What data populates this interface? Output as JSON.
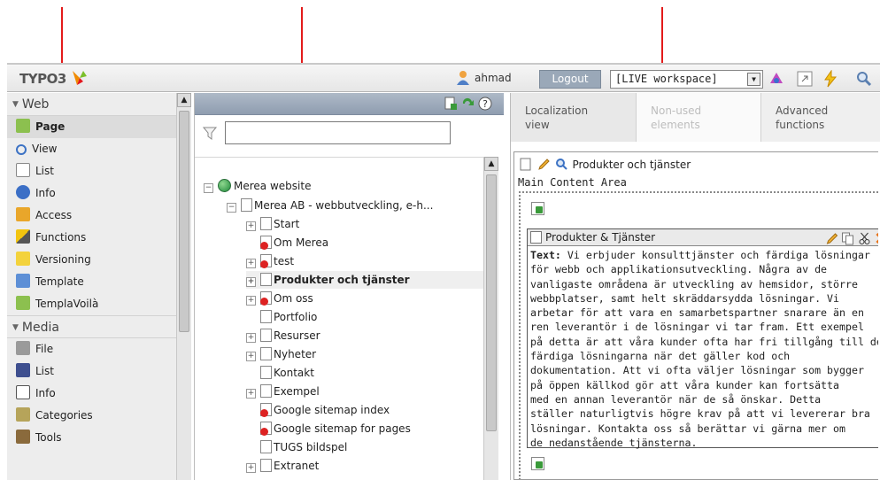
{
  "topbar": {
    "logo_text": "TYPO3",
    "username": "ahmad",
    "logout_label": "Logout",
    "workspace_value": "[LIVE workspace]"
  },
  "modules": {
    "web": {
      "label": "Web",
      "items": [
        {
          "label": "Page",
          "icon": "page-module-icon",
          "active": true
        },
        {
          "label": "View",
          "icon": "magnifier-icon"
        },
        {
          "label": "List",
          "icon": "list-icon"
        },
        {
          "label": "Info",
          "icon": "info-icon"
        },
        {
          "label": "Access",
          "icon": "lock-icon"
        },
        {
          "label": "Functions",
          "icon": "wand-icon"
        },
        {
          "label": "Versioning",
          "icon": "versioning-icon"
        },
        {
          "label": "Template",
          "icon": "template-icon"
        },
        {
          "label": "TemplaVoilà",
          "icon": "templavoila-icon"
        }
      ]
    },
    "media": {
      "label": "Media",
      "items": [
        {
          "label": "File",
          "icon": "folder-icon"
        },
        {
          "label": "List",
          "icon": "list-icon"
        },
        {
          "label": "Info",
          "icon": "info-icon"
        },
        {
          "label": "Categories",
          "icon": "categories-icon"
        },
        {
          "label": "Tools",
          "icon": "tools-icon"
        }
      ]
    }
  },
  "tree": {
    "filter_value": "",
    "root": "Merea website",
    "site": "Merea AB - webbutveckling, e-h...",
    "pages": [
      {
        "label": "Start",
        "expandable": true,
        "hidden": false
      },
      {
        "label": "Om Merea",
        "expandable": false,
        "hidden": true
      },
      {
        "label": "test",
        "expandable": true,
        "hidden": true
      },
      {
        "label": "Produkter och tjänster",
        "expandable": true,
        "hidden": false,
        "selected": true
      },
      {
        "label": "Om oss",
        "expandable": true,
        "hidden": true
      },
      {
        "label": "Portfolio",
        "expandable": false,
        "hidden": false
      },
      {
        "label": "Resurser",
        "expandable": true,
        "hidden": false
      },
      {
        "label": "Nyheter",
        "expandable": true,
        "hidden": false
      },
      {
        "label": "Kontakt",
        "expandable": false,
        "hidden": false
      },
      {
        "label": "Exempel",
        "expandable": true,
        "hidden": false
      },
      {
        "label": "Google sitemap index",
        "expandable": false,
        "hidden": true
      },
      {
        "label": "Google sitemap for pages",
        "expandable": false,
        "hidden": true
      },
      {
        "label": "TUGS bildspel",
        "expandable": false,
        "hidden": false
      },
      {
        "label": "Extranet",
        "expandable": true,
        "hidden": false
      }
    ]
  },
  "content": {
    "tabs": [
      {
        "label": "Localization\nview",
        "state": "normal"
      },
      {
        "label": "Non-used\nelements",
        "state": "inactive"
      },
      {
        "label": "Advanced\nfunctions",
        "state": "normal"
      }
    ],
    "page_title": "Produkter och tjänster",
    "area_label": "Main Content Area",
    "element": {
      "header": "Produkter & Tjänster",
      "text_label": "Text:",
      "text_lines": [
        " Vi erbjuder konsulttjänster och färdiga lösningar",
        "för webb och applikationsutveckling. Några av de",
        "vanligaste områdena är utveckling av hemsidor, större",
        "webbplatser, samt helt skräddarsydda lösningar. Vi",
        "arbetar för att vara en samarbetspartner snarare än en",
        "ren leverantör i de lösningar vi tar fram. Ett exempel",
        "på detta är att våra kunder ofta har fri tillgång till de",
        "färdiga lösningarna när det gäller kod och",
        "dokumentation. Att vi ofta väljer lösningar som bygger",
        "på öppen källkod gör att våra kunder kan fortsätta",
        "med en annan leverantör när de så önskar. Detta",
        "ställer naturligtvis högre krav på att vi levererar bra",
        "lösningar. Kontakta oss så berättar vi gärna mer om",
        "de nedanstående tjänsterna."
      ]
    }
  },
  "colors": {
    "annotation_arrow": "#e31b1b",
    "tree_header": "#9aa8b8",
    "logout_button": "#9aa8b8"
  }
}
